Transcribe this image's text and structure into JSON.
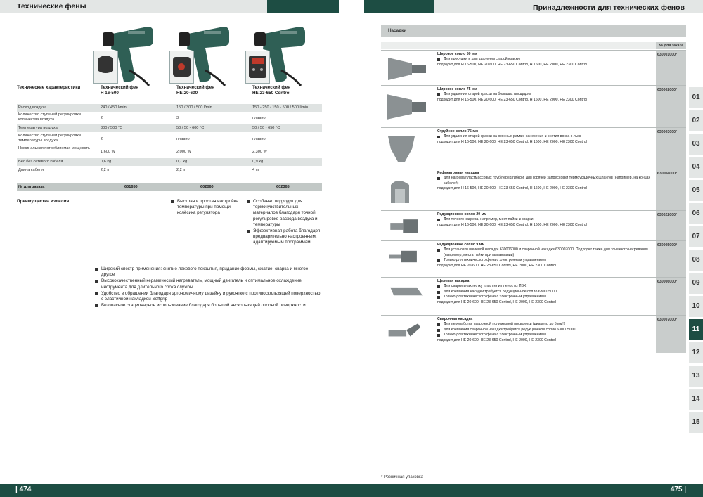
{
  "header": {
    "left_title": "Технические фены",
    "right_title": "Принадлежности для технических фенов"
  },
  "footer": {
    "left_page": "| 474",
    "right_page": "475 |",
    "footnote": "* Розничная упаковка"
  },
  "colors": {
    "brand": "#1d4d43",
    "shade": "#dfe3e2",
    "bar": "#c9cdcc"
  },
  "left_table": {
    "header_label": "Технические характеристики",
    "products": [
      {
        "name_line1": "Технический фен",
        "name_line2": "H 16-500"
      },
      {
        "name_line1": "Технический фен",
        "name_line2": "HE 20-600"
      },
      {
        "name_line1": "Технический фен",
        "name_line2": "HE 23-650 Control"
      }
    ],
    "rows": [
      {
        "label": "Расход воздуха",
        "v1": "240 / 450 l/min",
        "v2": "150 / 300 / 500 l/min",
        "v3": "150 - 250 / 150 - 500 / 500 l/min"
      },
      {
        "label": "Количество ступеней регулировки количества воздуха",
        "v1": "2",
        "v2": "3",
        "v3": "плавно"
      },
      {
        "label": "Температура воздуха",
        "v1": "300 / 500 °C",
        "v2": "50 / 50 - 600 °C",
        "v3": "50 / 50 - 650 °C"
      },
      {
        "label": "Количество ступеней регулировки температуры воздуха",
        "v1": "2",
        "v2": "плавно",
        "v3": "плавно"
      },
      {
        "label": "Номинальная потребляемая мощность",
        "v1": "1.600 W",
        "v2": "2.000 W",
        "v3": "2.300 W"
      },
      {
        "label": "Вес без сетевого кабеля",
        "v1": "0,6 kg",
        "v2": "0,7 kg",
        "v3": "0,9 kg"
      },
      {
        "label": "Длина кабеля",
        "v1": "2,2 m",
        "v2": "2,2 m",
        "v3": "4 m"
      }
    ],
    "order_label": "№ для заказа",
    "order_numbers": [
      "601650",
      "602060",
      "602365"
    ]
  },
  "advantages": {
    "label": "Преимущества изделия",
    "col2": [
      "Быстрая и простая настройка температуры при помощи колёсика регулятора"
    ],
    "col3": [
      "Особенно подходит для термочувствительных материалов благодаря точной регулировке расхода воздуха и температуры",
      "Эффективная работа благодаря предварительно настроенным, адаптируемым программам"
    ],
    "common": [
      "Широкий спектр применения: снятие лакового покрытия, придание формы, сжатие, сварка и многое другое",
      "Высококачественный керамический нагреватель, мощный двигатель и оптимальное охлаждение инструмента для длительного срока службы",
      "Удобство в обращении благодаря эргономичному дизайну и рукоятке с противоскользящей поверхностью с эластичной накладкой Softgrip",
      "Безопасное стационарное использование благодаря большой нескользящей опорной поверхности"
    ]
  },
  "accessories": {
    "section_title": "Насадки",
    "order_col": "№ для заказа",
    "items": [
      {
        "title": "Широкое сопло 50 мм",
        "bullets": [
          "Для просушки и для удаления старой краски"
        ],
        "fits": "подходит для H 16-500, HE 20-600, HE 23-650 Control, H 1600, HE 2000, HE 2300 Control",
        "code": "630001000*"
      },
      {
        "title": "Широкое сопло 75 мм",
        "bullets": [
          "Для удаления старой краски на больших площадях"
        ],
        "fits": "подходит для H 16-500, HE 20-600, HE 23-650 Control, H 1600, HE 2000, HE 2300 Control",
        "code": "630002000*"
      },
      {
        "title": "Струйное сопло 75 мм",
        "bullets": [
          "Для удаления старой краски на оконных рамах, нанесения и снятия воска с лыж"
        ],
        "fits": "подходит для H 16-500, HE 20-600, HE 23-650 Control, H 1600, HE 2000, HE 2300 Control",
        "code": "630003000*"
      },
      {
        "title": "Рефлекторная насадка",
        "bullets": [
          "Для нагрева пластмассовых труб перед гибкой; для горячей запрессовки термоусадочных шлангов (например, на концах кабелей)"
        ],
        "fits": "подходит для H 16-500, HE 20-600, HE 23-650 Control, H 1600, HE 2000, HE 2300 Control",
        "code": "630004000*"
      },
      {
        "title": "Редукционное сопло 20 мм",
        "bullets": [
          "Для точного нагрева, например, мест пайки и сварки"
        ],
        "fits": "подходит для H 16-500, HE 20-600, HE 23-650 Control, H 1600, HE 2000, HE 2300 Control",
        "code": "630022000*"
      },
      {
        "title": "Редукционное сопло 9 мм",
        "bullets": [
          "Для установки щелевой насадки 630006000 и сварочной насадки 630007000. Подходит также для точечного нагревания (например, места пайки при выпаивании)",
          "Только для технического фена с электронным управлением"
        ],
        "fits": "подходит для HE 20-600, HE 23-650 Control, HE 2000, HE 2300 Control",
        "code": "630005000*"
      },
      {
        "title": "Щелевая насадка",
        "bullets": [
          "Для сварки внахлестку пластин и пленок из ПВХ",
          "Для крепления насадки требуется редукционное сопло 630005000",
          "Только для технического фена с электронным управлением"
        ],
        "fits": "подходит для HE 20-600, HE 23-650 Control, HE 2000, HE 2300 Control",
        "code": "630006000*"
      },
      {
        "title": "Сварочная насадка",
        "bullets": [
          "Для переработки сварочной полимерной проволоки (диаметр до 5 мм!)",
          "Для крепления сварочной насадки требуется редукционное сопло 630005000",
          "Только для технического фена с электронным управлением"
        ],
        "fits": "подходит для HE 20-600, HE 23-650 Control, HE 2000, HE 2300 Control",
        "code": "630007000*"
      }
    ]
  },
  "tabs": [
    "01",
    "02",
    "03",
    "04",
    "05",
    "06",
    "07",
    "08",
    "09",
    "10",
    "11",
    "12",
    "13",
    "14",
    "15"
  ],
  "active_tab": "11"
}
